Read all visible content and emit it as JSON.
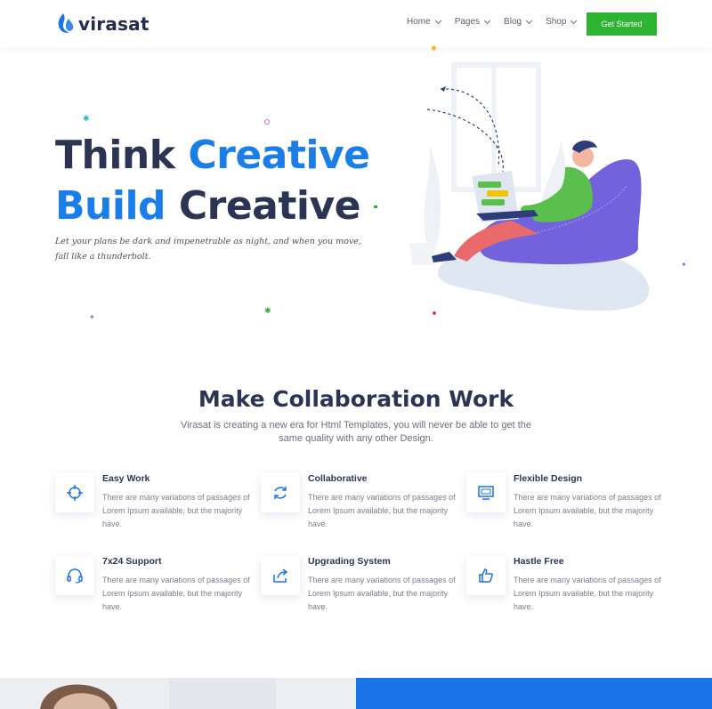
{
  "header": {
    "logo_text": "virasat",
    "nav": [
      {
        "label": "Home"
      },
      {
        "label": "Pages"
      },
      {
        "label": "Blog"
      },
      {
        "label": "Shop"
      }
    ],
    "cta_label": "Get Started"
  },
  "hero": {
    "line1_a": "Think ",
    "line1_b": "Creative",
    "line2_a": "Build",
    "line2_b": " Creative",
    "subtitle": "Let your plans be dark and impenetrable as night, and when you move, fall like a thunderbolt."
  },
  "section": {
    "title": "Make Collaboration Work",
    "subtitle": "Virasat is creating a new era for Html Templates, you will never be able to get the same quality with any other Design."
  },
  "features": [
    {
      "title": "Easy Work",
      "desc": "There are many variations of passages of Lorem Ipsum available, but the majority have.",
      "icon": "crosshair-icon"
    },
    {
      "title": "Collaborative",
      "desc": "There are many variations of passages of Lorem Ipsum available, but the majority have.",
      "icon": "sync-icon"
    },
    {
      "title": "Flexible Design",
      "desc": "There are many variations of passages of Lorem Ipsum available, but the majority have.",
      "icon": "monitor-icon"
    },
    {
      "title": "7x24 Support",
      "desc": "There are many variations of passages of Lorem Ipsum available, but the majority have.",
      "icon": "headset-icon"
    },
    {
      "title": "Upgrading System",
      "desc": "There are many variations of passages of Lorem Ipsum available, but the majority have.",
      "icon": "share-icon"
    },
    {
      "title": "Hastle Free",
      "desc": "There are many variations of passages of Lorem Ipsum available, but the majority have.",
      "icon": "thumbs-up-icon"
    }
  ],
  "colors": {
    "accent": "#1a7de8",
    "cta": "#2db432",
    "heading": "#2c3454"
  }
}
